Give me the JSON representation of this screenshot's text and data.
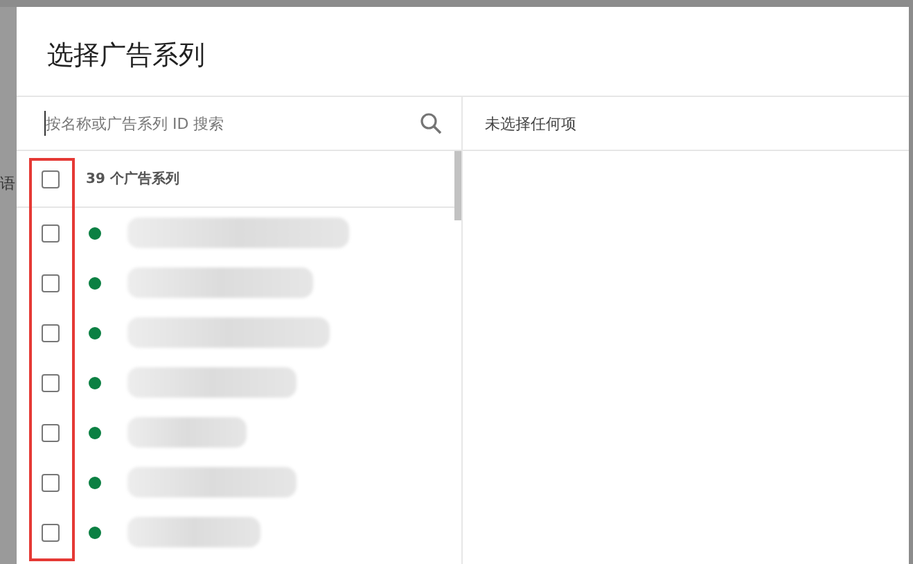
{
  "backdrop": {
    "text": "语"
  },
  "dialog": {
    "title": "选择广告系列"
  },
  "search": {
    "placeholder": "按名称或广告系列 ID 搜索"
  },
  "selection": {
    "empty_text": "未选择任何项"
  },
  "list": {
    "header": {
      "label": "39 个广告系列",
      "checked": false
    },
    "rows": [
      {
        "checked": false,
        "color": "#0b8043"
      },
      {
        "checked": false,
        "color": "#0b8043"
      },
      {
        "checked": false,
        "color": "#0b8043"
      },
      {
        "checked": false,
        "color": "#0b8043"
      },
      {
        "checked": false,
        "color": "#0b8043"
      },
      {
        "checked": false,
        "color": "#0b8043"
      },
      {
        "checked": false,
        "color": "#0b8043"
      }
    ]
  }
}
